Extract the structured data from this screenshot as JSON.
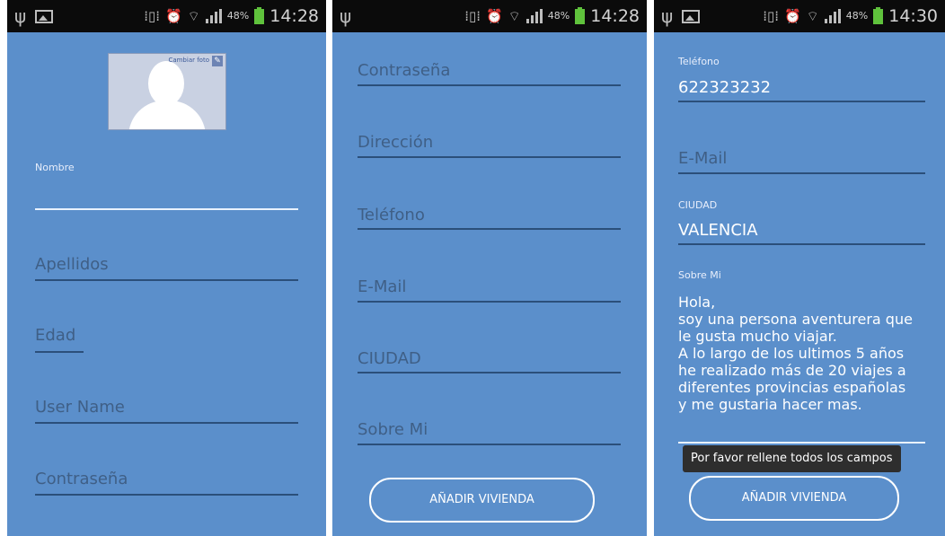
{
  "status_bar": {
    "screen1": {
      "battery_pct": "48%",
      "time": "14:28"
    },
    "screen2": {
      "battery_pct": "48%",
      "time": "14:28"
    },
    "screen3": {
      "battery_pct": "48%",
      "time": "14:30"
    }
  },
  "screen1": {
    "photo": {
      "change_label": "Cambiar foto"
    },
    "nombre": {
      "label": "Nombre",
      "value": ""
    },
    "apellidos": {
      "placeholder": "Apellidos"
    },
    "edad": {
      "placeholder": "Edad"
    },
    "user_name": {
      "placeholder": "User Name"
    },
    "contrasena": {
      "placeholder": "Contraseña"
    }
  },
  "screen2": {
    "contrasena": {
      "placeholder": "Contraseña"
    },
    "direccion": {
      "placeholder": "Dirección"
    },
    "telefono": {
      "placeholder": "Teléfono"
    },
    "email": {
      "placeholder": "E-Mail"
    },
    "ciudad": {
      "placeholder": "CIUDAD"
    },
    "sobre_mi": {
      "placeholder": "Sobre Mi"
    },
    "add_button": "AÑADIR VIVIENDA"
  },
  "screen3": {
    "telefono": {
      "label": "Teléfono",
      "value": "622323232"
    },
    "email": {
      "placeholder": "E-Mail"
    },
    "ciudad": {
      "label": "CIUDAD",
      "value": "VALENCIA"
    },
    "sobre_mi": {
      "label": "Sobre Mi",
      "lines": [
        "Hola,",
        "soy una persona aventurera que",
        "le gusta mucho viajar.",
        "A lo largo de los ultimos 5 años",
        "he realizado más de 20 viajes a",
        "diferentes provincias españolas",
        "y me gustaria hacer mas."
      ]
    },
    "toast": "Por favor rellene todos los campos",
    "add_button": "AÑADIR VIVIENDA"
  },
  "colors": {
    "background": "#5b8fcb",
    "status_bar": "#0b0b0b",
    "text_white": "#ffffff",
    "hint": "#3f5f86"
  },
  "icons": [
    "usb-icon",
    "gallery-icon",
    "vibrate-icon",
    "alarm-icon",
    "wifi-icon",
    "signal-icon",
    "battery-charging-icon",
    "edit-icon"
  ]
}
